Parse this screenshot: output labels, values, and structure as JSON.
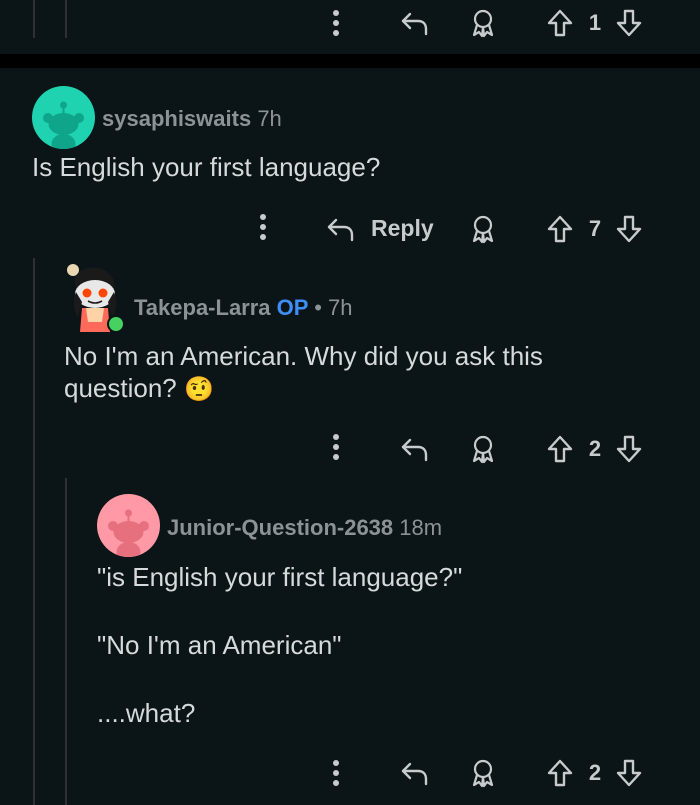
{
  "top_actions": {
    "vote_count": "1"
  },
  "comments": [
    {
      "username": "sysaphiswaits",
      "time": "7h",
      "text": "Is English your first language?",
      "reply_label": "Reply",
      "vote_count": "7"
    },
    {
      "username": "Takepa-Larra",
      "op_badge": "OP",
      "time": "7h",
      "text": "No I'm an American. Why did you ask this question?",
      "emoji": "🤨",
      "vote_count": "2"
    },
    {
      "username": "Junior-Question-2638",
      "time": "18m",
      "lines": [
        "\"is English your first language?\"",
        "\"No I'm an American\"",
        "....what?"
      ],
      "vote_count": "2"
    }
  ],
  "colors": {
    "background": "#0b1416",
    "text": "#d7dadc",
    "muted": "#8b9396",
    "op_blue": "#3d8ef8",
    "avatar_teal": "#1fd3b1",
    "avatar_pink": "#ff99a5"
  },
  "icons": [
    "more-icon",
    "reply-icon",
    "award-icon",
    "upvote-icon",
    "downvote-icon",
    "snoo-avatar-icon",
    "online-dot-icon"
  ]
}
